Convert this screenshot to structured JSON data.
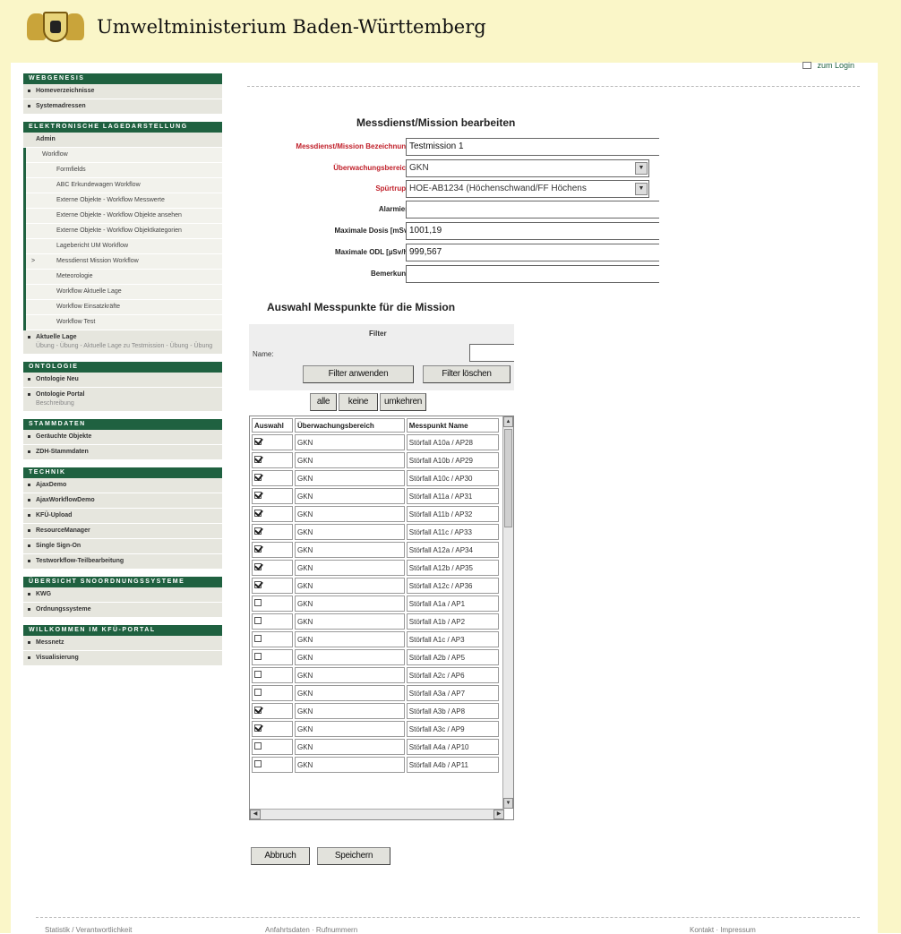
{
  "site": {
    "title": "Umweltministerium Baden-Württemberg"
  },
  "login": "zum Login",
  "sidebar": {
    "sections": [
      {
        "title": "WEBGENESIS",
        "items": [
          {
            "label": "Homeverzeichnisse"
          },
          {
            "label": "Systemadressen"
          }
        ]
      },
      {
        "title": "ELEKTRONISCHE LAGEDARSTELLUNG",
        "items": [
          {
            "label": "Admin"
          }
        ],
        "sub": [
          {
            "label": "Workflow",
            "level": 1
          },
          {
            "label": "Formfields"
          },
          {
            "label": "ABC Erkundewagen Workflow"
          },
          {
            "label": "Externe Objekte - Workflow Messwerte"
          },
          {
            "label": "Externe Objekte - Workflow Objekte ansehen"
          },
          {
            "label": "Externe Objekte - Workflow Objektkategorien"
          },
          {
            "label": "Lagebericht UM Workflow"
          },
          {
            "label": "Messdienst Mission Workflow",
            "mark": ">"
          },
          {
            "label": "Meteorologie"
          },
          {
            "label": "Workflow Aktuelle Lage"
          },
          {
            "label": "Workflow Einsatzkräfte"
          },
          {
            "label": "Workflow Test"
          }
        ],
        "after": {
          "label": "Aktuelle Lage",
          "sub": "Übung - Übung - Aktuelle Lage zu Testmission - Übung - Übung"
        }
      },
      {
        "title": "ONTOLOGIE",
        "items": [
          {
            "label": "Ontologie Neu"
          },
          {
            "label": "Ontologie Portal",
            "sub": "Beschreibung"
          }
        ]
      },
      {
        "title": "STAMMDATEN",
        "items": [
          {
            "label": "Geräuchte Objekte"
          },
          {
            "label": "ZDH-Stammdaten"
          }
        ]
      },
      {
        "title": "TECHNIK",
        "items": [
          {
            "label": "AjaxDemo"
          },
          {
            "label": "AjaxWorkflowDemo"
          },
          {
            "label": "KFÜ-Upload"
          },
          {
            "label": "ResourceManager"
          },
          {
            "label": "Single Sign-On"
          },
          {
            "label": "Testworkflow-Teilbearbeitung"
          }
        ]
      },
      {
        "title": "ÜBERSICHT SNOORDNUNGSSYSTEME",
        "items": [
          {
            "label": "KWG"
          },
          {
            "label": "Ordnungssysteme"
          }
        ]
      },
      {
        "title": "WILLKOMMEN IM KFÜ-PORTAL",
        "items": [
          {
            "label": "Messnetz"
          },
          {
            "label": "Visualisierung"
          }
        ]
      }
    ]
  },
  "form": {
    "title": "Messdienst/Mission bearbeiten",
    "fields": {
      "name": {
        "label": "Messdienst/Mission Bezeichnung",
        "value": "Testmission 1"
      },
      "area": {
        "label": "Überwachungsbereich",
        "value": "GKN"
      },
      "team": {
        "label": "Spürtrupp",
        "value": "HOE-AB1234 (Höchenschwand/FF Höchens"
      },
      "alarm": {
        "label": "Alarmiert",
        "value": ""
      },
      "dose": {
        "label": "Maximale Dosis [mSv]",
        "value": "1001,19"
      },
      "odl": {
        "label": "Maximale ODL [µSv/h]",
        "value": "999,567"
      },
      "remark": {
        "label": "Bemerkung",
        "value": ""
      }
    }
  },
  "selection": {
    "title": "Auswahl Messpunkte für die Mission",
    "filter_title": "Filter",
    "name_label": "Name:",
    "apply": "Filter anwenden",
    "clear": "Filter löschen",
    "all": "alle",
    "none": "keine",
    "invert": "umkehren",
    "columns": [
      "Auswahl",
      "Überwachungsbereich",
      "Messpunkt Name"
    ],
    "rows": [
      {
        "checked": true,
        "area": "GKN",
        "name": "Störfall A10a / AP28"
      },
      {
        "checked": true,
        "area": "GKN",
        "name": "Störfall A10b / AP29"
      },
      {
        "checked": true,
        "area": "GKN",
        "name": "Störfall A10c / AP30"
      },
      {
        "checked": true,
        "area": "GKN",
        "name": "Störfall A11a / AP31"
      },
      {
        "checked": true,
        "area": "GKN",
        "name": "Störfall A11b / AP32"
      },
      {
        "checked": true,
        "area": "GKN",
        "name": "Störfall A11c / AP33"
      },
      {
        "checked": true,
        "area": "GKN",
        "name": "Störfall A12a / AP34"
      },
      {
        "checked": true,
        "area": "GKN",
        "name": "Störfall A12b / AP35"
      },
      {
        "checked": true,
        "area": "GKN",
        "name": "Störfall A12c / AP36"
      },
      {
        "checked": false,
        "area": "GKN",
        "name": "Störfall A1a / AP1"
      },
      {
        "checked": false,
        "area": "GKN",
        "name": "Störfall A1b / AP2"
      },
      {
        "checked": false,
        "area": "GKN",
        "name": "Störfall A1c / AP3"
      },
      {
        "checked": false,
        "area": "GKN",
        "name": "Störfall A2b / AP5"
      },
      {
        "checked": false,
        "area": "GKN",
        "name": "Störfall A2c / AP6"
      },
      {
        "checked": false,
        "area": "GKN",
        "name": "Störfall A3a / AP7"
      },
      {
        "checked": true,
        "area": "GKN",
        "name": "Störfall A3b / AP8"
      },
      {
        "checked": true,
        "area": "GKN",
        "name": "Störfall A3c / AP9"
      },
      {
        "checked": false,
        "area": "GKN",
        "name": "Störfall A4a / AP10"
      },
      {
        "checked": false,
        "area": "GKN",
        "name": "Störfall A4b / AP11"
      }
    ]
  },
  "actions": {
    "cancel": "Abbruch",
    "save": "Speichern"
  },
  "footer": {
    "left": "Statistik / Verantwortlichkeit",
    "middle": "Anfahrtsdaten · Rufnummern",
    "right": "Kontakt · Impressum"
  },
  "colors": {
    "frame": "#faf6c8",
    "nav_green": "#1f6140",
    "required_red": "#c0202a"
  }
}
